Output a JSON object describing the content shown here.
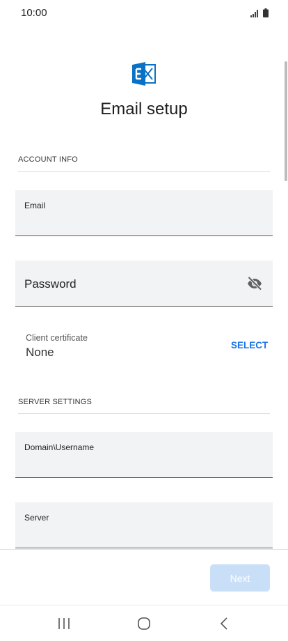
{
  "status_bar": {
    "time": "10:00"
  },
  "header": {
    "title": "Email setup"
  },
  "account_info": {
    "section_title": "ACCOUNT INFO",
    "email_label": "Email",
    "password_label": "Password",
    "client_certificate_label": "Client certificate",
    "client_certificate_value": "None",
    "select_label": "SELECT"
  },
  "server_settings": {
    "section_title": "SERVER SETTINGS",
    "domain_username_label": "Domain\\Username",
    "server_label": "Server"
  },
  "footer": {
    "next_label": "Next"
  },
  "colors": {
    "accent": "#1a73e8",
    "field_bg": "#f1f3f4",
    "next_disabled": "#c9dff7",
    "exchange_blue": "#0a72c6"
  }
}
